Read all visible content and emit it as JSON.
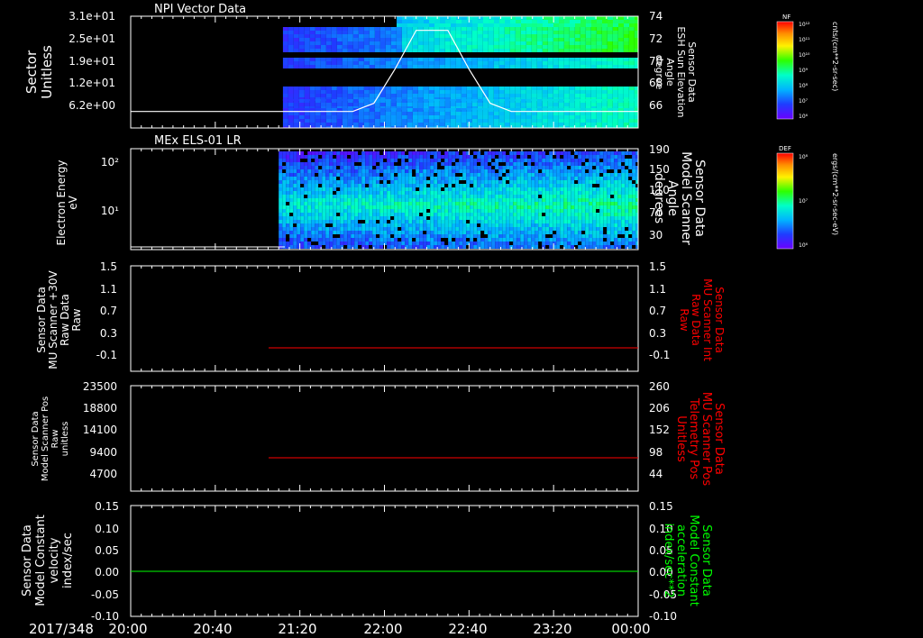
{
  "chart_data": [
    {
      "type": "heatmap",
      "title": "NPI Vector Data",
      "ylabel": [
        "Sector",
        "Unitless"
      ],
      "yticks": [
        "3.1e+01",
        "2.5e+01",
        "1.9e+01",
        "1.2e+01",
        "6.2e+00"
      ],
      "y2label": [
        "Sensor Data",
        "ESH Sun Elevation",
        "Angle",
        "degree"
      ],
      "y2ticks": [
        "74",
        "72",
        "70",
        "68",
        "66"
      ],
      "y2lim": [
        64.5,
        74
      ],
      "data_start_time": "21:12",
      "overlay_line": {
        "name": "ESH Sun Elevation Angle",
        "color": "#ffffff",
        "x": [
          "20:00",
          "21:45",
          "21:55",
          "22:05",
          "22:15",
          "22:30",
          "22:40",
          "22:50",
          "23:00",
          "00:00"
        ],
        "y": [
          65.9,
          65.9,
          66.6,
          69.5,
          72.8,
          72.8,
          69.5,
          66.6,
          65.9,
          65.9
        ]
      },
      "colorbar": {
        "label": "cnts/(cm**2-sr-sec)",
        "tag": "NF",
        "ticks": [
          "10¹²",
          "10¹¹",
          "10¹⁰",
          "10⁹",
          "10⁸",
          "10⁷",
          "10⁶"
        ]
      }
    },
    {
      "type": "heatmap",
      "title": "MEx ELS-01 LR",
      "ylabel": [
        "Electron Energy",
        "eV"
      ],
      "yticks": [
        "10²",
        "10¹"
      ],
      "ylog": true,
      "y2label": [
        "Sensor Data",
        "Model Scanner",
        "Angle",
        "degrees"
      ],
      "y2ticks": [
        "190",
        "150",
        "110",
        "70",
        "30"
      ],
      "data_start_time": "21:10",
      "colorbar": {
        "label": "ergs/(cm**2-sr-sec-eV)",
        "tag": "DEF",
        "ticks": [
          "10⁸",
          "10⁷",
          "10⁶"
        ]
      }
    },
    {
      "type": "line",
      "ylabel": [
        "Sensor Data",
        "MU Scanner +30V",
        "Raw Data",
        "Raw"
      ],
      "yticks": [
        "1.5",
        "1.1",
        "0.7",
        "0.3",
        "-0.1"
      ],
      "ylim": [
        -0.3,
        1.5
      ],
      "y2label": [
        "Sensor Data",
        "MU Scanner Int",
        "Raw Data",
        "Raw"
      ],
      "y2ticks": [
        "1.5",
        "1.1",
        "0.7",
        "0.3",
        "-0.1"
      ],
      "series": [
        {
          "name": "MU Scanner Int",
          "color": "#ff0000",
          "x": [
            "21:00",
            "00:00"
          ],
          "y": [
            0.0,
            0.0
          ]
        }
      ]
    },
    {
      "type": "line",
      "ylabel": [
        "Sensor Data",
        "Model Scanner Pos",
        "Raw",
        "unitless"
      ],
      "yticks": [
        "23500",
        "18800",
        "14100",
        "9400",
        "4700"
      ],
      "ylim": [
        0,
        23500
      ],
      "y2label": [
        "Sensor Data",
        "MU Scanner Pos",
        "Telemetry Pos",
        "Unitless"
      ],
      "y2ticks": [
        "260",
        "206",
        "152",
        "98",
        "44"
      ],
      "y2lim": [
        0,
        260
      ],
      "series": [
        {
          "name": "MU Scanner Pos Telemetry Pos",
          "color": "#ff0000",
          "x": [
            "21:00",
            "00:00"
          ],
          "y2": [
            90,
            90
          ]
        }
      ]
    },
    {
      "type": "line",
      "ylabel": [
        "Sensor Data",
        "Model Constant",
        "velocity",
        "index/sec"
      ],
      "yticks": [
        "0.15",
        "0.10",
        "0.05",
        "0.00",
        "-0.05",
        "-0.10"
      ],
      "ylim": [
        -0.1,
        0.15
      ],
      "y2label": [
        "Sensor Data",
        "Model Constant",
        "acceleration",
        "index/sec**2"
      ],
      "y2ticks": [
        "0.15",
        "0.10",
        "0.05",
        "0.00",
        "-0.05",
        "-0.10"
      ],
      "series": [
        {
          "name": "Model Constant acceleration",
          "color": "#00ff00",
          "x": [
            "20:00",
            "00:00"
          ],
          "y": [
            0.0,
            0.0
          ]
        }
      ]
    }
  ],
  "time_axis": {
    "date": "2017/348",
    "ticks": [
      "20:00",
      "20:40",
      "21:20",
      "22:00",
      "22:40",
      "23:20",
      "00:00"
    ],
    "range": [
      "20:00",
      "00:00"
    ]
  },
  "colors": {
    "background": "#000000",
    "axis": "#ffffff",
    "red_label": "#ff0000",
    "green_label": "#00ff00"
  }
}
